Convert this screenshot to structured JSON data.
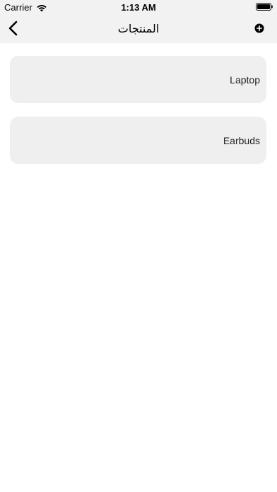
{
  "status_bar": {
    "carrier": "Carrier",
    "time": "1:13 AM",
    "wifi_icon": "wifi-icon",
    "battery_icon": "battery-icon"
  },
  "nav_bar": {
    "title": "المنتجات",
    "back_icon": "chevron-left-icon",
    "add_icon": "plus-circle-icon",
    "background": "#f2f2f2"
  },
  "products": [
    {
      "name": "Laptop"
    },
    {
      "name": "Earbuds"
    }
  ],
  "colors": {
    "card_background": "#efefef",
    "page_background": "#ffffff"
  }
}
